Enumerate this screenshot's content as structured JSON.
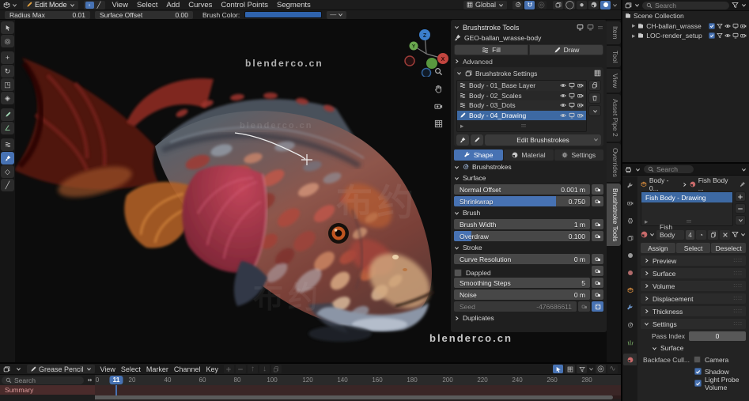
{
  "viewport_header": {
    "mode_selector": "Edit Mode",
    "menus": [
      "View",
      "Select",
      "Add",
      "Curves",
      "Control Points",
      "Segments"
    ],
    "orientation_label": "Global"
  },
  "tool_settings": {
    "radius_label": "Radius Max",
    "radius_value": "0.01",
    "offset_label": "Surface Offset",
    "offset_value": "0.00",
    "brush_color_label": "Brush Color:",
    "brush_color": "#2f63ad",
    "overflow_label": "—"
  },
  "viewport": {
    "watermark_top": "blenderco.cn",
    "watermark_faint": "blenderco.cn",
    "watermark_bottom": "blenderco.cn",
    "watermark_cjk": "布约",
    "gizmo": {
      "x": "X",
      "y": "Y",
      "z": "Z"
    }
  },
  "npanel": {
    "title": "Brushstroke Tools",
    "object_ref": "GEO-ballan_wrasse-body",
    "fill_button": "Fill",
    "draw_button": "Draw",
    "advanced_label": "Advanced",
    "settings_header": "Brushstroke Settings",
    "layers": [
      {
        "label": "Body - 01_Base Layer"
      },
      {
        "label": "Body - 02_Scales"
      },
      {
        "label": "Body - 03_Dots"
      },
      {
        "label": "Body - 04_Drawing"
      }
    ],
    "edit_button": "Edit Brushstrokes",
    "tabs": [
      "Shape",
      "Material",
      "Settings"
    ],
    "brushstrokes_header": "Brushstrokes",
    "surface_header": "Surface",
    "surface_rows": [
      {
        "label": "Normal Offset",
        "value": "0.001 m"
      },
      {
        "label": "Shrinkwrap",
        "value": "0.750"
      }
    ],
    "brush_header": "Brush",
    "brush_rows": [
      {
        "label": "Brush Width",
        "value": "1 m"
      },
      {
        "label": "Overdraw",
        "value": "0.100"
      }
    ],
    "stroke_header": "Stroke",
    "curve_resolution": {
      "label": "Curve Resolution",
      "value": "0 m"
    },
    "dappled_label": "Dappled",
    "smoothing": {
      "label": "Smoothing Steps",
      "value": "5"
    },
    "noise": {
      "label": "Noise",
      "value": "0 m"
    },
    "seed": {
      "label": "Seed",
      "value": "-476686611"
    },
    "duplicates_label": "Duplicates"
  },
  "side_tabs": [
    "Item",
    "Tool",
    "View",
    "Asset Pipe 2",
    "Overrides",
    "Brushstroke Tools"
  ],
  "outliner": {
    "search_placeholder": "Search",
    "scene_collection": "Scene Collection",
    "rows": [
      {
        "label": "CH-ballan_wrasse"
      },
      {
        "label": "LOC-render_setup"
      }
    ]
  },
  "properties": {
    "search_placeholder": "Search",
    "breadcrumb_object": "Body - 0...",
    "breadcrumb_material": "Fish Body ...",
    "slot_selected": "Fish Body - Drawing",
    "material_name": "Fish Body ...",
    "material_users": "4",
    "assign_button": "Assign",
    "select_button": "Select",
    "deselect_button": "Deselect",
    "sections": [
      "Preview",
      "Surface",
      "Volume",
      "Displacement",
      "Thickness"
    ],
    "settings_label": "Settings",
    "pass_index_label": "Pass Index",
    "pass_index_value": "0",
    "surface_sub_label": "Surface",
    "backface_label": "Backface Cull...",
    "checkboxes": [
      {
        "label": "Camera",
        "checked": false
      },
      {
        "label": "Shadow",
        "checked": true
      },
      {
        "label": "Light Probe Volume",
        "checked": true
      }
    ]
  },
  "timeline": {
    "mode": "Grease Pencil",
    "menus": [
      "View",
      "Select",
      "Marker",
      "Channel",
      "Key"
    ],
    "search_placeholder": "Search",
    "summary_label": "Summary",
    "current_frame": "11",
    "ticks": [
      "0",
      "20",
      "40",
      "60",
      "80",
      "100",
      "120",
      "140",
      "160",
      "180",
      "200",
      "220",
      "240",
      "260",
      "280"
    ]
  }
}
